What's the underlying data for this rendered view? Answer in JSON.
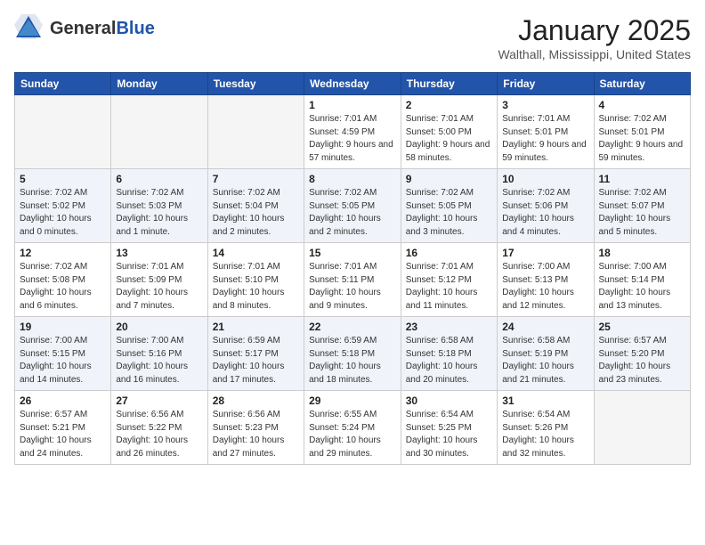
{
  "header": {
    "logo_general": "General",
    "logo_blue": "Blue",
    "month_title": "January 2025",
    "location": "Walthall, Mississippi, United States"
  },
  "weekdays": [
    "Sunday",
    "Monday",
    "Tuesday",
    "Wednesday",
    "Thursday",
    "Friday",
    "Saturday"
  ],
  "weeks": [
    [
      {
        "day": "",
        "info": ""
      },
      {
        "day": "",
        "info": ""
      },
      {
        "day": "",
        "info": ""
      },
      {
        "day": "1",
        "info": "Sunrise: 7:01 AM\nSunset: 4:59 PM\nDaylight: 9 hours and 57 minutes."
      },
      {
        "day": "2",
        "info": "Sunrise: 7:01 AM\nSunset: 5:00 PM\nDaylight: 9 hours and 58 minutes."
      },
      {
        "day": "3",
        "info": "Sunrise: 7:01 AM\nSunset: 5:01 PM\nDaylight: 9 hours and 59 minutes."
      },
      {
        "day": "4",
        "info": "Sunrise: 7:02 AM\nSunset: 5:01 PM\nDaylight: 9 hours and 59 minutes."
      }
    ],
    [
      {
        "day": "5",
        "info": "Sunrise: 7:02 AM\nSunset: 5:02 PM\nDaylight: 10 hours and 0 minutes."
      },
      {
        "day": "6",
        "info": "Sunrise: 7:02 AM\nSunset: 5:03 PM\nDaylight: 10 hours and 1 minute."
      },
      {
        "day": "7",
        "info": "Sunrise: 7:02 AM\nSunset: 5:04 PM\nDaylight: 10 hours and 2 minutes."
      },
      {
        "day": "8",
        "info": "Sunrise: 7:02 AM\nSunset: 5:05 PM\nDaylight: 10 hours and 2 minutes."
      },
      {
        "day": "9",
        "info": "Sunrise: 7:02 AM\nSunset: 5:05 PM\nDaylight: 10 hours and 3 minutes."
      },
      {
        "day": "10",
        "info": "Sunrise: 7:02 AM\nSunset: 5:06 PM\nDaylight: 10 hours and 4 minutes."
      },
      {
        "day": "11",
        "info": "Sunrise: 7:02 AM\nSunset: 5:07 PM\nDaylight: 10 hours and 5 minutes."
      }
    ],
    [
      {
        "day": "12",
        "info": "Sunrise: 7:02 AM\nSunset: 5:08 PM\nDaylight: 10 hours and 6 minutes."
      },
      {
        "day": "13",
        "info": "Sunrise: 7:01 AM\nSunset: 5:09 PM\nDaylight: 10 hours and 7 minutes."
      },
      {
        "day": "14",
        "info": "Sunrise: 7:01 AM\nSunset: 5:10 PM\nDaylight: 10 hours and 8 minutes."
      },
      {
        "day": "15",
        "info": "Sunrise: 7:01 AM\nSunset: 5:11 PM\nDaylight: 10 hours and 9 minutes."
      },
      {
        "day": "16",
        "info": "Sunrise: 7:01 AM\nSunset: 5:12 PM\nDaylight: 10 hours and 11 minutes."
      },
      {
        "day": "17",
        "info": "Sunrise: 7:00 AM\nSunset: 5:13 PM\nDaylight: 10 hours and 12 minutes."
      },
      {
        "day": "18",
        "info": "Sunrise: 7:00 AM\nSunset: 5:14 PM\nDaylight: 10 hours and 13 minutes."
      }
    ],
    [
      {
        "day": "19",
        "info": "Sunrise: 7:00 AM\nSunset: 5:15 PM\nDaylight: 10 hours and 14 minutes."
      },
      {
        "day": "20",
        "info": "Sunrise: 7:00 AM\nSunset: 5:16 PM\nDaylight: 10 hours and 16 minutes."
      },
      {
        "day": "21",
        "info": "Sunrise: 6:59 AM\nSunset: 5:17 PM\nDaylight: 10 hours and 17 minutes."
      },
      {
        "day": "22",
        "info": "Sunrise: 6:59 AM\nSunset: 5:18 PM\nDaylight: 10 hours and 18 minutes."
      },
      {
        "day": "23",
        "info": "Sunrise: 6:58 AM\nSunset: 5:18 PM\nDaylight: 10 hours and 20 minutes."
      },
      {
        "day": "24",
        "info": "Sunrise: 6:58 AM\nSunset: 5:19 PM\nDaylight: 10 hours and 21 minutes."
      },
      {
        "day": "25",
        "info": "Sunrise: 6:57 AM\nSunset: 5:20 PM\nDaylight: 10 hours and 23 minutes."
      }
    ],
    [
      {
        "day": "26",
        "info": "Sunrise: 6:57 AM\nSunset: 5:21 PM\nDaylight: 10 hours and 24 minutes."
      },
      {
        "day": "27",
        "info": "Sunrise: 6:56 AM\nSunset: 5:22 PM\nDaylight: 10 hours and 26 minutes."
      },
      {
        "day": "28",
        "info": "Sunrise: 6:56 AM\nSunset: 5:23 PM\nDaylight: 10 hours and 27 minutes."
      },
      {
        "day": "29",
        "info": "Sunrise: 6:55 AM\nSunset: 5:24 PM\nDaylight: 10 hours and 29 minutes."
      },
      {
        "day": "30",
        "info": "Sunrise: 6:54 AM\nSunset: 5:25 PM\nDaylight: 10 hours and 30 minutes."
      },
      {
        "day": "31",
        "info": "Sunrise: 6:54 AM\nSunset: 5:26 PM\nDaylight: 10 hours and 32 minutes."
      },
      {
        "day": "",
        "info": ""
      }
    ]
  ]
}
